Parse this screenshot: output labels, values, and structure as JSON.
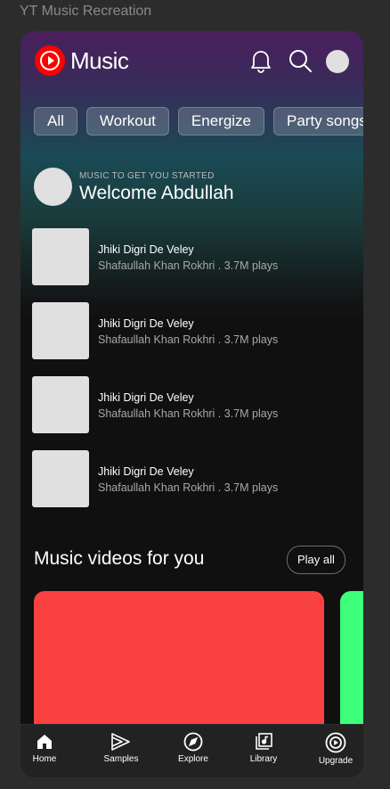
{
  "frame_title": "YT Music Recreation",
  "header": {
    "brand": "Music",
    "colors": {
      "logo": "#ff0000",
      "gradient_top": "#4a1f5c",
      "gradient_mid": "#1a4a55"
    },
    "icons": [
      "notification-bell-icon",
      "search-icon",
      "avatar"
    ]
  },
  "chips": [
    "All",
    "Workout",
    "Energize",
    "Party songs"
  ],
  "welcome": {
    "subtitle": "MUSIC TO GET YOU STARTED",
    "title": "Welcome Abdullah"
  },
  "songs": [
    {
      "title": "Jhiki Digri De Veley",
      "meta": "Shafaullah Khan Rokhri . 3.7M plays"
    },
    {
      "title": "Jhiki Digri De Veley",
      "meta": "Shafaullah Khan Rokhri . 3.7M plays"
    },
    {
      "title": "Jhiki Digri De Veley",
      "meta": "Shafaullah Khan Rokhri . 3.7M plays"
    },
    {
      "title": "Jhiki Digri De Veley",
      "meta": "Shafaullah Khan Rokhri . 3.7M plays"
    }
  ],
  "videos_section": {
    "title": "Music videos for you",
    "play_all": "Play all",
    "card_colors": [
      "#fa4141",
      "#3dff7a"
    ]
  },
  "bottom_nav": [
    {
      "label": "Home",
      "icon": "home-icon"
    },
    {
      "label": "Samples",
      "icon": "samples-icon"
    },
    {
      "label": "Explore",
      "icon": "explore-icon"
    },
    {
      "label": "Library",
      "icon": "library-icon"
    },
    {
      "label": "Upgrade",
      "icon": "upgrade-icon"
    }
  ]
}
